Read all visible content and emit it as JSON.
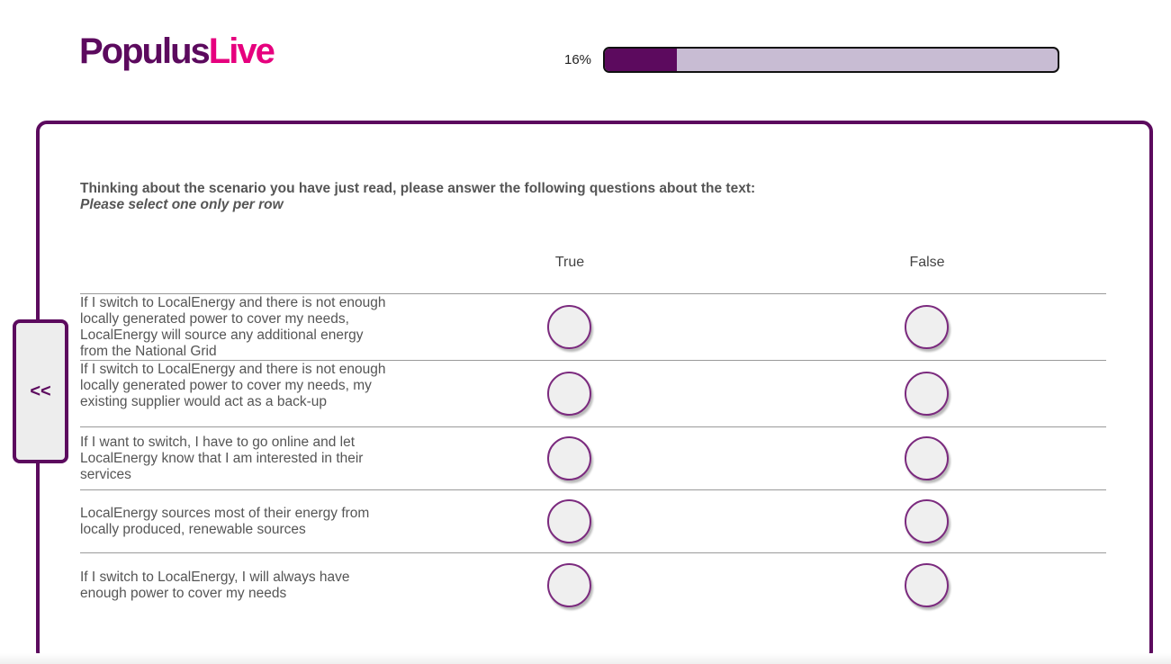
{
  "logo": {
    "part1": "Populus",
    "part2": "Live",
    "color_primary": "#5c0a5e",
    "color_accent": "#e6007e"
  },
  "progress": {
    "label": "16%",
    "value_percent": 16
  },
  "navigation": {
    "back_label": "<<"
  },
  "question": {
    "text": "Thinking about the scenario you have just read, please answer the following questions about the text:",
    "instruction": "Please select one only per row"
  },
  "columns": [
    "True",
    "False"
  ],
  "rows": [
    {
      "text": "If I switch to LocalEnergy and there is not enough locally generated power to cover my needs, LocalEnergy will source any additional energy from the National Grid"
    },
    {
      "text": "If I switch to LocalEnergy and there is not enough locally generated power to cover my needs, my existing supplier would act as a back-up"
    },
    {
      "text": "If I want to switch, I have to go online and let LocalEnergy know that I am interested in their services"
    },
    {
      "text": "LocalEnergy sources most of their energy from locally produced, renewable sources"
    },
    {
      "text": "If I switch to LocalEnergy, I will always have enough power to cover my needs"
    }
  ]
}
